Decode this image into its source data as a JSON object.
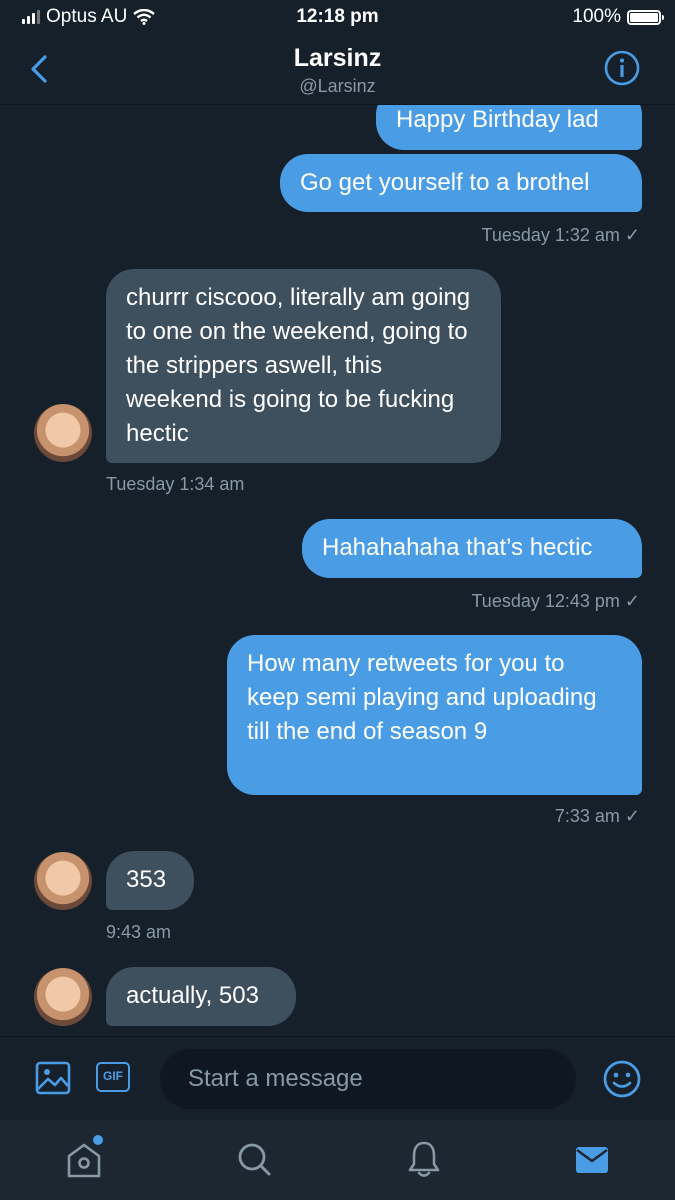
{
  "status_bar": {
    "carrier": "Optus AU",
    "time": "12:18 pm",
    "battery": "100%"
  },
  "header": {
    "name": "Larsinz",
    "handle": "@Larsinz"
  },
  "messages": [
    {
      "text": "Happy Birthday lad",
      "from": "me"
    },
    {
      "text": "Go get yourself to a brothel",
      "from": "me",
      "meta": "Tuesday 1:32 am ✓"
    },
    {
      "text": "churrr ciscooo, literally am going to one on the weekend, going to the strippers aswell, this weekend is going to be fucking hectic",
      "from": "them",
      "meta": "Tuesday 1:34 am"
    },
    {
      "text": "Hahahahaha that’s hectic",
      "from": "me",
      "meta": "Tuesday 12:43 pm ✓"
    },
    {
      "text": "How many retweets for you to keep semi playing and uploading till the end of season 9",
      "from": "me",
      "meta": "7:33 am ✓"
    },
    {
      "text": "353",
      "from": "them",
      "meta": "9:43 am"
    },
    {
      "text": "actually, 503",
      "from": "them"
    }
  ],
  "compose": {
    "placeholder": "Start a message",
    "gif_label": "GIF"
  },
  "colors": {
    "background": "#15202b",
    "sent_bubble": "#4a9de5",
    "received_bubble": "#3e4f5d",
    "accent": "#4a9de5"
  }
}
